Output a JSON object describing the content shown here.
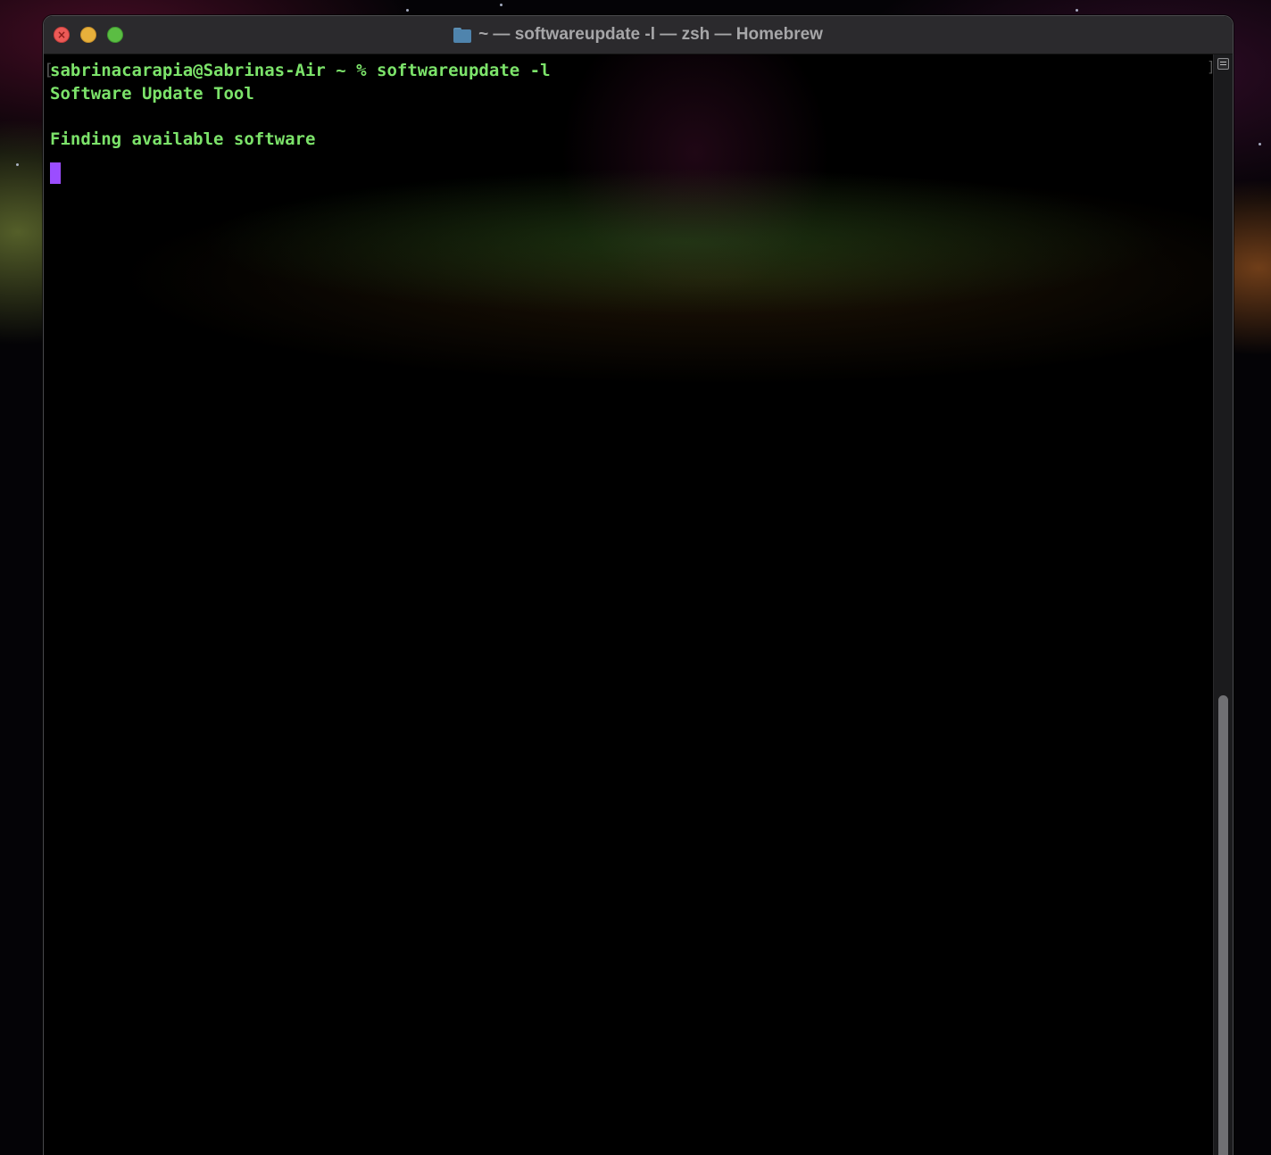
{
  "window": {
    "title": "~ — softwareupdate -l — zsh — Homebrew",
    "title_icon": "folder-icon",
    "controls": [
      "close-icon",
      "minimize-icon",
      "zoom-icon"
    ]
  },
  "terminal": {
    "lines": [
      "sabrinacarapia@Sabrinas-Air ~ % softwareupdate -l",
      "Software Update Tool",
      "",
      "Finding available software"
    ],
    "text_color": "#7ce36a",
    "cursor_color": "#9b4dff",
    "theme": "Homebrew"
  }
}
